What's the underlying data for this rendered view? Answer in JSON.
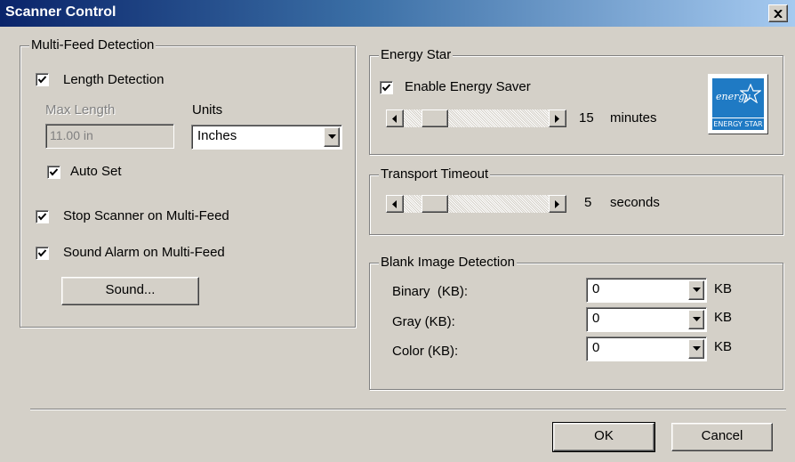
{
  "window": {
    "title": "Scanner Control"
  },
  "multifeed": {
    "group_title": "Multi-Feed Detection",
    "length_detection": {
      "label": "Length Detection",
      "checked": true
    },
    "max_length": {
      "label": "Max Length",
      "value": "11.00 in"
    },
    "units": {
      "label": "Units",
      "value": "Inches"
    },
    "auto_set": {
      "label": "Auto Set",
      "checked": true
    },
    "stop_scanner": {
      "label": "Stop Scanner on Multi-Feed",
      "checked": true
    },
    "sound_alarm": {
      "label": "Sound Alarm on Multi-Feed",
      "checked": true
    },
    "sound_button": "Sound..."
  },
  "energy_star": {
    "group_title": "Energy Star",
    "enable": {
      "label": "Enable Energy Saver",
      "checked": true
    },
    "value": "15",
    "unit": "minutes",
    "logo_script": "energy",
    "logo_caption": "ENERGY STAR"
  },
  "transport": {
    "group_title": "Transport Timeout",
    "value": "5",
    "unit": "seconds"
  },
  "blank_image": {
    "group_title": "Blank Image Detection",
    "rows": [
      {
        "label": "Binary  (KB):",
        "value": "0",
        "unit": "KB"
      },
      {
        "label": "Gray (KB):",
        "value": "0",
        "unit": "KB"
      },
      {
        "label": "Color (KB):",
        "value": "0",
        "unit": "KB"
      }
    ]
  },
  "footer": {
    "ok": "OK",
    "cancel": "Cancel"
  }
}
